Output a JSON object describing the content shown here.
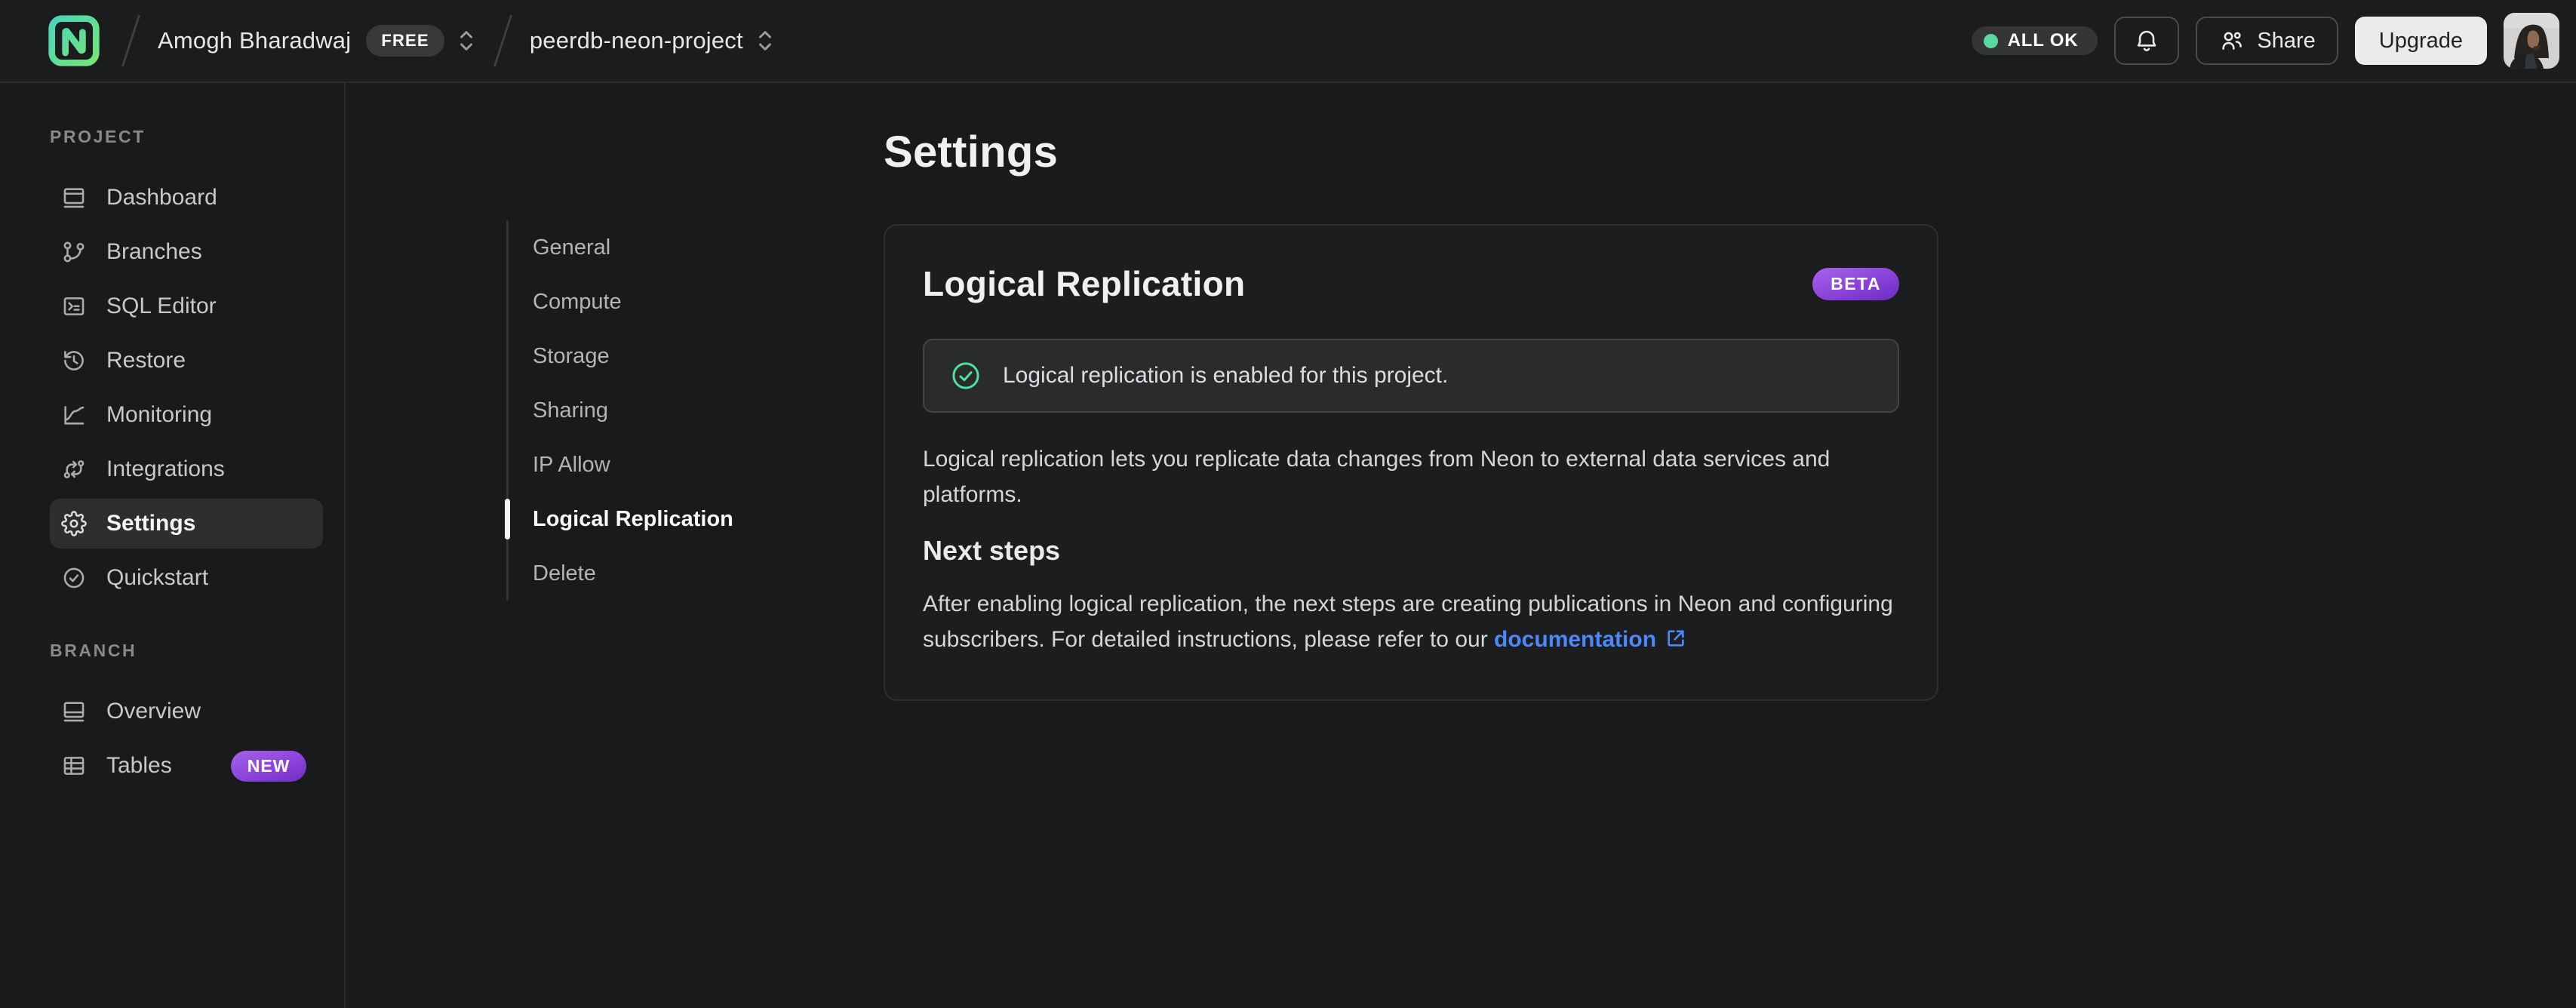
{
  "topbar": {
    "org_name": "Amogh Bharadwaj",
    "org_badge": "FREE",
    "project_name": "peerdb-neon-project",
    "status_label": "ALL OK",
    "share_label": "Share",
    "upgrade_label": "Upgrade"
  },
  "sidebar": {
    "sections": [
      {
        "label": "PROJECT",
        "items": [
          {
            "label": "Dashboard"
          },
          {
            "label": "Branches"
          },
          {
            "label": "SQL Editor"
          },
          {
            "label": "Restore"
          },
          {
            "label": "Monitoring"
          },
          {
            "label": "Integrations"
          },
          {
            "label": "Settings"
          },
          {
            "label": "Quickstart"
          }
        ]
      },
      {
        "label": "BRANCH",
        "items": [
          {
            "label": "Overview"
          },
          {
            "label": "Tables",
            "badge": "NEW"
          }
        ]
      }
    ],
    "active_item": "Settings"
  },
  "settings_nav": {
    "active": "Logical Replication",
    "items": [
      {
        "label": "General"
      },
      {
        "label": "Compute"
      },
      {
        "label": "Storage"
      },
      {
        "label": "Sharing"
      },
      {
        "label": "IP Allow"
      },
      {
        "label": "Logical Replication"
      },
      {
        "label": "Delete"
      }
    ]
  },
  "main": {
    "page_title": "Settings",
    "card": {
      "title": "Logical Replication",
      "badge": "BETA",
      "status_banner": "Logical replication is enabled for this project.",
      "description": "Logical replication lets you replicate data changes from Neon to external data services and platforms.",
      "next_steps_title": "Next steps",
      "next_steps_text": "After enabling logical replication, the next steps are creating publications in Neon and configuring subscribers. For detailed instructions, please refer to our ",
      "link_label": "documentation"
    }
  },
  "icons": {
    "logo": "neon-logo",
    "breadcrumb_selector": "chevron-up-down",
    "status": "green-dot",
    "notifications": "bell",
    "share": "people",
    "banner": "check-circle",
    "link": "external-link"
  },
  "colors": {
    "brand_green": "#00e599",
    "status_dot": "#58d9a1",
    "success_check": "#4ee39c",
    "badge_purple": "#8a41da",
    "link_blue": "#4d87f8"
  }
}
